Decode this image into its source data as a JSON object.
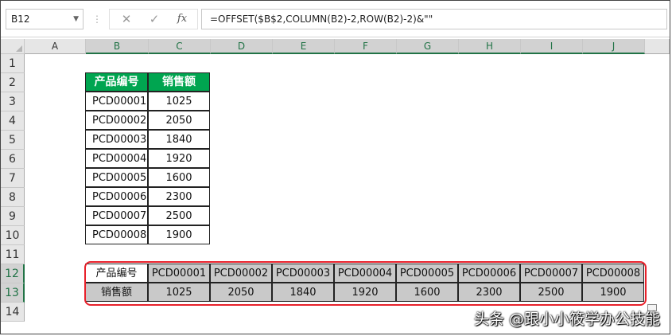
{
  "formula_bar": {
    "name_box": "B12",
    "cancel_icon": "✕",
    "enter_icon": "✓",
    "fx_label": "fx",
    "formula": "=OFFSET($B$2,COLUMN(B2)-2,ROW(B2)-2)&\"\""
  },
  "columns": [
    "A",
    "B",
    "C",
    "D",
    "E",
    "F",
    "G",
    "H",
    "I",
    "J"
  ],
  "rows": [
    "1",
    "2",
    "3",
    "4",
    "5",
    "6",
    "7",
    "8",
    "9",
    "10",
    "11",
    "12",
    "13",
    "14"
  ],
  "source_table": {
    "headers": [
      "产品编号",
      "销售额"
    ],
    "rows": [
      [
        "PCD00001",
        "1025"
      ],
      [
        "PCD00002",
        "2050"
      ],
      [
        "PCD00003",
        "1840"
      ],
      [
        "PCD00004",
        "1920"
      ],
      [
        "PCD00005",
        "1600"
      ],
      [
        "PCD00006",
        "2300"
      ],
      [
        "PCD00007",
        "2500"
      ],
      [
        "PCD00008",
        "1900"
      ]
    ]
  },
  "transposed_table": {
    "row1_label": "产品编号",
    "row1": [
      "PCD00001",
      "PCD00002",
      "PCD00003",
      "PCD00004",
      "PCD00005",
      "PCD00006",
      "PCD00007",
      "PCD00008"
    ],
    "row2_label": "销售额",
    "row2": [
      "1025",
      "2050",
      "1840",
      "1920",
      "1600",
      "2300",
      "2500",
      "1900"
    ]
  },
  "watermark": "头条 @跟小小筱学办公技能",
  "colors": {
    "header_green": "#00a550",
    "highlight_red": "#e8212b",
    "excel_green": "#217346",
    "transposed_fill": "#c9c9c9"
  }
}
